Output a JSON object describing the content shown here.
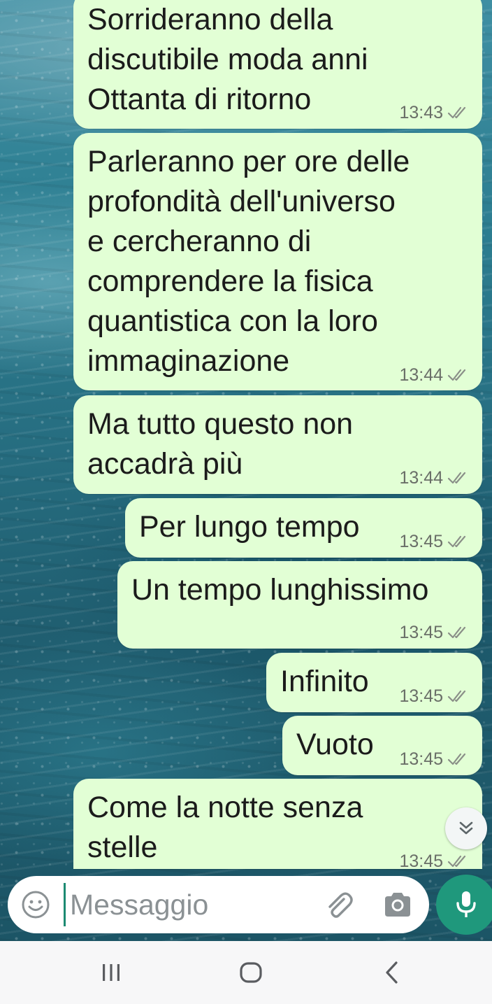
{
  "messages": [
    {
      "text": "Sorrideranno della\ndiscutibile moda anni\nOttanta di ritorno",
      "time": "13:43"
    },
    {
      "text": "Parleranno per ore delle\nprofondità dell'universo\ne cercheranno di\ncomprendere la fisica\nquantistica con la loro\nimmaginazione",
      "time": "13:44"
    },
    {
      "text": "Ma tutto questo non\naccadrà più",
      "time": "13:44"
    },
    {
      "text": "Per lungo tempo",
      "time": "13:45"
    },
    {
      "text": "Un tempo lunghissimo",
      "time": "13:45"
    },
    {
      "text": "Infinito",
      "time": "13:45"
    },
    {
      "text": "Vuoto",
      "time": "13:45"
    },
    {
      "text": "Come la notte senza\nstelle",
      "time": "13:45"
    }
  ],
  "composer": {
    "placeholder": "Messaggio",
    "value": ""
  },
  "icons": {
    "emoji": "emoji-icon",
    "attach": "paperclip-icon",
    "camera": "camera-icon",
    "mic": "microphone-icon",
    "scroll": "double-chevron-down-icon",
    "read_receipt": "double-check-icon",
    "nav_recents": "recents-icon",
    "nav_home": "home-icon",
    "nav_back": "back-icon"
  },
  "colors": {
    "bubble": "#e2ffd5",
    "accent": "#1f987c",
    "timestamp": "#6a6f68"
  }
}
